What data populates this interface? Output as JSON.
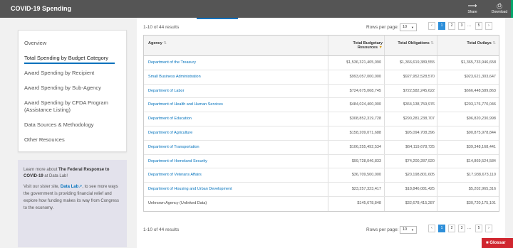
{
  "header": {
    "title": "COVID-19 Spending",
    "share_label": "Share",
    "download_label": "Download"
  },
  "sidebar": {
    "items": [
      {
        "label": "Overview",
        "active": false
      },
      {
        "label": "Total Spending by Budget Category",
        "active": true
      },
      {
        "label": "Award Spending by Recipient",
        "active": false
      },
      {
        "label": "Award Spending by Sub-Agency",
        "active": false
      },
      {
        "label": "Award Spending by CFDA Program (Assistance Listing)",
        "active": false
      },
      {
        "label": "Data Sources & Methodology",
        "active": false
      },
      {
        "label": "Other Resources",
        "active": false
      }
    ]
  },
  "promo": {
    "intro": "Learn more about",
    "highlight": "The Federal Response to COVID-19",
    "suffix": "at Data Lab!",
    "visit": "Visit our sister site,",
    "link": "Data Lab",
    "rest": ", to see more ways the government is providing financial relief and explore how funding makes its way from Congress to the economy."
  },
  "pagination": {
    "results_label": "1-10 of 44 results",
    "rows_per_page_label": "Rows per page:",
    "rows_per_page_value": "10",
    "pages": [
      "1",
      "2",
      "3",
      "5"
    ],
    "ellipsis": "...",
    "prev": "‹",
    "next": "›"
  },
  "table": {
    "headers": {
      "agency": "Agency",
      "budgetary": "Total Budgetary Resources",
      "obligations": "Total Obligations",
      "outlays": "Total Outlays"
    },
    "rows": [
      {
        "agency": "Department of the Treasury",
        "budgetary": "$1,536,321,405,090",
        "obligations": "$1,366,619,389,555",
        "outlays": "$1,365,733,946,658"
      },
      {
        "agency": "Small Business Administration",
        "budgetary": "$993,057,000,000",
        "obligations": "$927,952,528,570",
        "outlays": "$923,621,303,647"
      },
      {
        "agency": "Department of Labor",
        "budgetary": "$724,675,068,745",
        "obligations": "$722,582,245,622",
        "outlays": "$666,448,589,863"
      },
      {
        "agency": "Department of Health and Human Services",
        "budgetary": "$484,024,400,000",
        "obligations": "$364,138,759,976",
        "outlays": "$203,176,770,046"
      },
      {
        "agency": "Department of Education",
        "budgetary": "$308,852,319,728",
        "obligations": "$290,281,238,707",
        "outlays": "$96,820,230,998"
      },
      {
        "agency": "Department of Agriculture",
        "budgetary": "$158,209,071,688",
        "obligations": "$95,094,708,396",
        "outlays": "$90,875,978,844"
      },
      {
        "agency": "Department of Transportation",
        "budgetary": "$106,255,492,534",
        "obligations": "$64,119,678,725",
        "outlays": "$39,348,168,441"
      },
      {
        "agency": "Department of Homeland Security",
        "budgetary": "$99,728,046,833",
        "obligations": "$74,200,287,920",
        "outlays": "$14,869,524,584"
      },
      {
        "agency": "Department of Veterans Affairs",
        "budgetary": "$36,709,500,000",
        "obligations": "$20,198,801,605",
        "outlays": "$17,938,673,110"
      },
      {
        "agency": "Department of Housing and Urban Development",
        "budgetary": "$23,257,323,417",
        "obligations": "$18,846,081,425",
        "outlays": "$5,202,965,316"
      },
      {
        "agency": "Unknown Agency (Unlinked Data)",
        "budgetary": "$145,678,848",
        "obligations": "$32,678,415,287",
        "outlays": "$30,720,175,101",
        "unlinked": true
      }
    ]
  },
  "glossary": {
    "label": "Glossar"
  },
  "colors": {
    "accent": "#0071bc",
    "header_bg": "#555555",
    "glossary_bg": "#d0262f",
    "active_page": "#2e8fd9"
  }
}
